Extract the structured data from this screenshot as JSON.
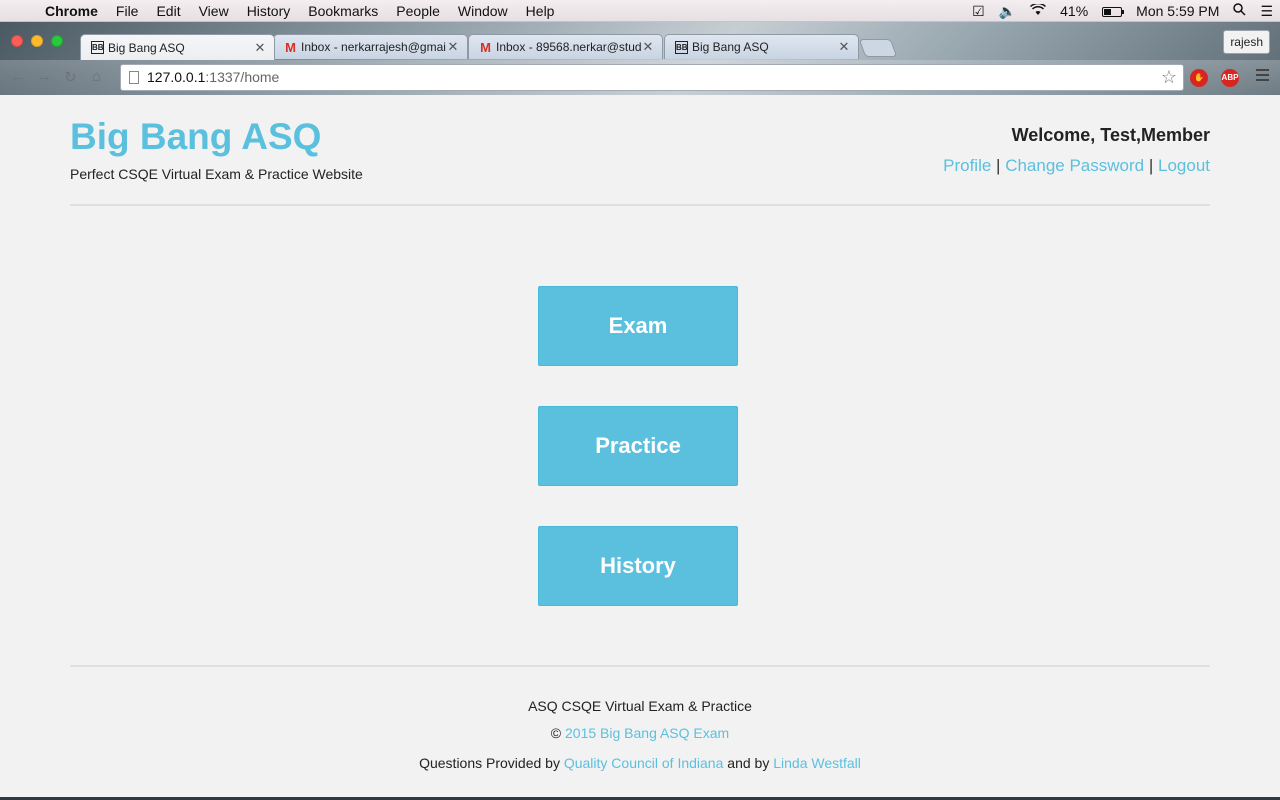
{
  "menubar": {
    "app": "Chrome",
    "items": [
      "File",
      "Edit",
      "View",
      "History",
      "Bookmarks",
      "People",
      "Window",
      "Help"
    ],
    "battery": "41%",
    "clock": "Mon 5:59 PM"
  },
  "browser": {
    "tabs": [
      {
        "title": "Big Bang ASQ",
        "favicon": "BB"
      },
      {
        "title": "Inbox - nerkarrajesh@gmai",
        "favicon": "gmail-icon"
      },
      {
        "title": "Inbox - 89568.nerkar@stud",
        "favicon": "gmail-icon"
      },
      {
        "title": "Big Bang ASQ",
        "favicon": "BB"
      }
    ],
    "profile": "rajesh",
    "url_host": "127.0.0.1",
    "url_path": ":1337/home"
  },
  "site": {
    "brand": "Big Bang ASQ",
    "tagline": "Perfect CSQE Virtual Exam & Practice Website",
    "welcome": "Welcome, Test,Member",
    "links": {
      "profile": "Profile",
      "change_password": "Change Password",
      "logout": "Logout",
      "separator": "|"
    },
    "buttons": {
      "exam": "Exam",
      "practice": "Practice",
      "history": "History"
    },
    "footer": {
      "title": "ASQ CSQE Virtual Exam & Practice",
      "copyright_symbol": "©",
      "copyright_link": "2015 Big Bang ASQ Exam",
      "credits_prefix": "Questions Provided by",
      "credits_link1": "Quality Council of Indiana",
      "credits_and": "and by",
      "credits_link2": "Linda Westfall"
    }
  },
  "colors": {
    "accent": "#5bc0de",
    "page_bg": "#f2f2f2"
  }
}
